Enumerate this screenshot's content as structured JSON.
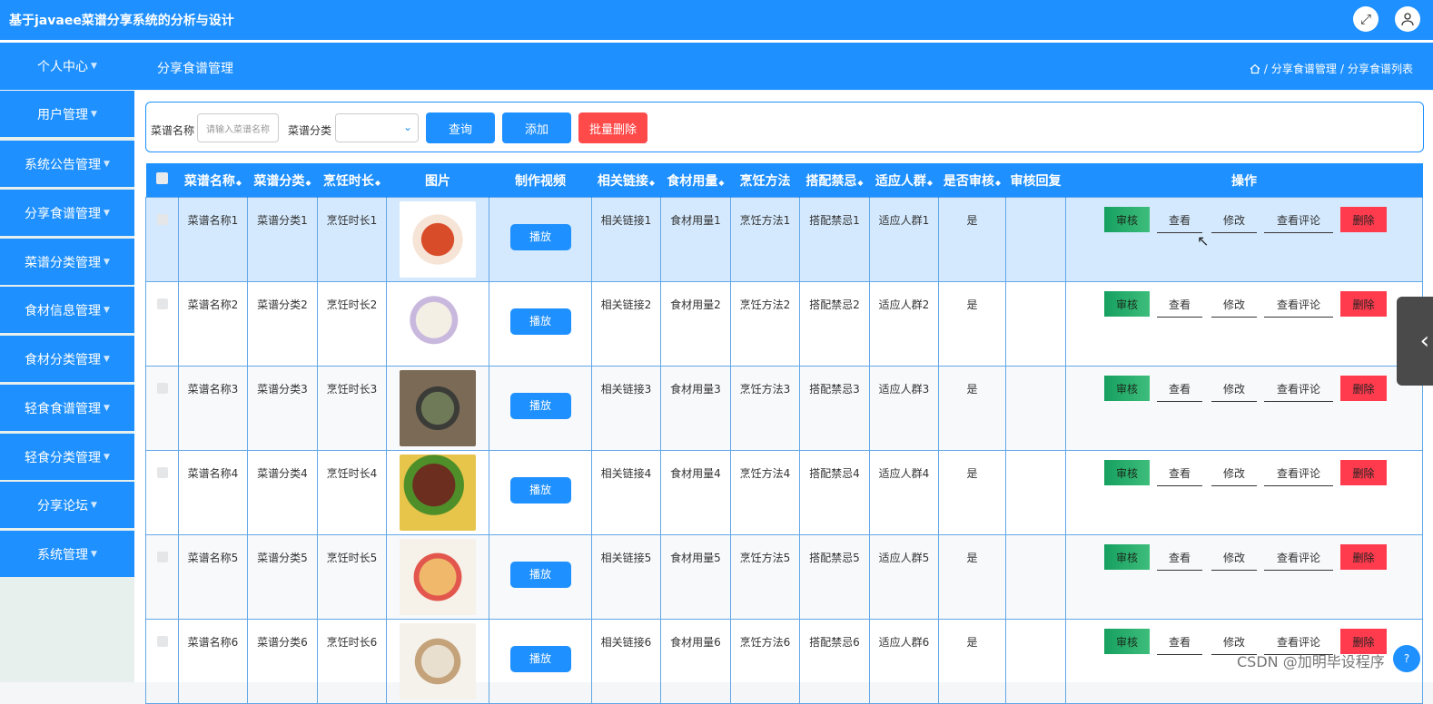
{
  "app": {
    "title": "基于javaee菜谱分享系统的分析与设计",
    "fullscreen_icon": "fullscreen-icon",
    "user_icon": "user-icon"
  },
  "header": {
    "first_menu": "个人中心",
    "page_title": "分享食谱管理",
    "breadcrumb": {
      "home_icon": "home-icon",
      "level1": "分享食谱管理",
      "level2": "分享食谱列表",
      "separator": "/"
    }
  },
  "sidebar": {
    "items": [
      {
        "label": "用户管理"
      },
      {
        "label": "系统公告管理"
      },
      {
        "label": "分享食谱管理"
      },
      {
        "label": "菜谱分类管理"
      },
      {
        "label": "食材信息管理"
      },
      {
        "label": "食材分类管理"
      },
      {
        "label": "轻食食谱管理"
      },
      {
        "label": "轻食分类管理"
      },
      {
        "label": "分享论坛"
      },
      {
        "label": "系统管理"
      }
    ]
  },
  "search": {
    "name_label": "菜谱名称",
    "name_placeholder": "请输入菜谱名称",
    "category_label": "菜谱分类",
    "category_value": "",
    "query_button": "查询",
    "add_button": "添加",
    "batch_delete_button": "批量删除"
  },
  "colors": {
    "primary": "#1e90ff",
    "danger": "#ff3b4d",
    "audit": "#16a060"
  },
  "table": {
    "columns": [
      "菜谱名称",
      "菜谱分类",
      "烹饪时长",
      "图片",
      "制作视频",
      "相关链接",
      "食材用量",
      "烹饪方法",
      "搭配禁忌",
      "适应人群",
      "是否审核",
      "审核回复",
      "操作"
    ],
    "play_label": "播放",
    "actions": {
      "audit": "审核",
      "view": "查看",
      "edit": "修改",
      "comment": "查看评论",
      "delete": "删除"
    },
    "rows": [
      {
        "name": "菜谱名称1",
        "category": "菜谱分类1",
        "duration": "烹饪时长1",
        "link": "相关链接1",
        "ingredients": "食材用量1",
        "method": "烹饪方法1",
        "taboo": "搭配禁忌1",
        "crowd": "适应人群1",
        "audited": "是",
        "reply": ""
      },
      {
        "name": "菜谱名称2",
        "category": "菜谱分类2",
        "duration": "烹饪时长2",
        "link": "相关链接2",
        "ingredients": "食材用量2",
        "method": "烹饪方法2",
        "taboo": "搭配禁忌2",
        "crowd": "适应人群2",
        "audited": "是",
        "reply": ""
      },
      {
        "name": "菜谱名称3",
        "category": "菜谱分类3",
        "duration": "烹饪时长3",
        "link": "相关链接3",
        "ingredients": "食材用量3",
        "method": "烹饪方法3",
        "taboo": "搭配禁忌3",
        "crowd": "适应人群3",
        "audited": "是",
        "reply": ""
      },
      {
        "name": "菜谱名称4",
        "category": "菜谱分类4",
        "duration": "烹饪时长4",
        "link": "相关链接4",
        "ingredients": "食材用量4",
        "method": "烹饪方法4",
        "taboo": "搭配禁忌4",
        "crowd": "适应人群4",
        "audited": "是",
        "reply": ""
      },
      {
        "name": "菜谱名称5",
        "category": "菜谱分类5",
        "duration": "烹饪时长5",
        "link": "相关链接5",
        "ingredients": "食材用量5",
        "method": "烹饪方法5",
        "taboo": "搭配禁忌5",
        "crowd": "适应人群5",
        "audited": "是",
        "reply": ""
      },
      {
        "name": "菜谱名称6",
        "category": "菜谱分类6",
        "duration": "烹饪时长6",
        "link": "相关链接6",
        "ingredients": "食材用量6",
        "method": "烹饪方法6",
        "taboo": "搭配禁忌6",
        "crowd": "适应人群6",
        "audited": "是",
        "reply": ""
      }
    ]
  },
  "watermark": "CSDN @加明毕设程序"
}
